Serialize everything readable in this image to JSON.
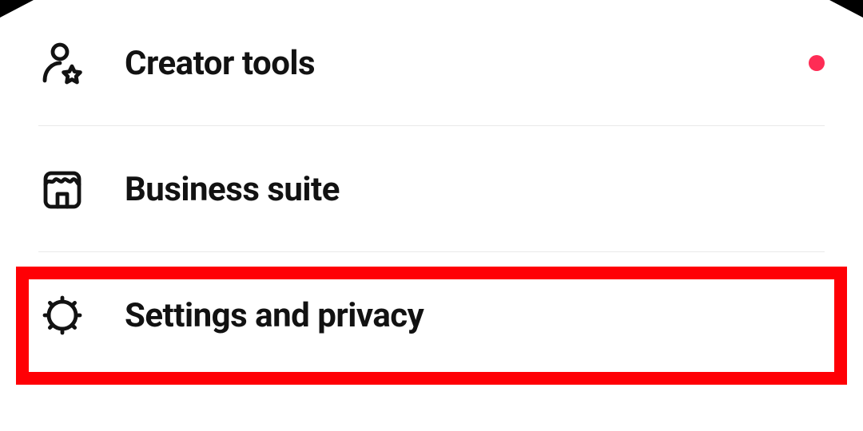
{
  "menu": {
    "items": [
      {
        "label": "Creator tools",
        "icon": "person-star-icon",
        "notification": true
      },
      {
        "label": "Business suite",
        "icon": "storefront-icon",
        "notification": false
      },
      {
        "label": "Settings and privacy",
        "icon": "gear-icon",
        "notification": false
      }
    ]
  },
  "colors": {
    "accent": "#fe2c55",
    "highlight_border": "#ff0005"
  }
}
